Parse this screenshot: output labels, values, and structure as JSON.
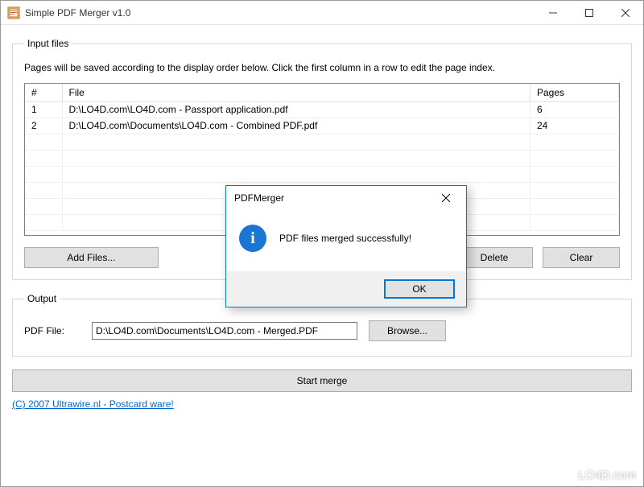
{
  "window": {
    "title": "Simple PDF Merger v1.0"
  },
  "input_group": {
    "legend": "Input files",
    "instructions": "Pages will be saved according to the display order below. Click the first column in a row to edit the page index.",
    "columns": {
      "idx": "#",
      "file": "File",
      "pages": "Pages"
    },
    "rows": [
      {
        "idx": "1",
        "file": "D:\\LO4D.com\\LO4D.com - Passport application.pdf",
        "pages": "6"
      },
      {
        "idx": "2",
        "file": "D:\\LO4D.com\\Documents\\LO4D.com - Combined PDF.pdf",
        "pages": "24"
      }
    ],
    "buttons": {
      "add": "Add Files...",
      "delete": "Delete",
      "clear": "Clear"
    }
  },
  "output_group": {
    "legend": "Output",
    "label": "PDF File:",
    "value": "D:\\LO4D.com\\Documents\\LO4D.com - Merged.PDF",
    "browse": "Browse..."
  },
  "start_label": "Start merge",
  "credit": "(C) 2007 Ultrawire.nl - Postcard ware!",
  "dialog": {
    "title": "PDFMerger",
    "message": "PDF files merged successfully!",
    "ok": "OK"
  },
  "watermark": "LO4D.com"
}
